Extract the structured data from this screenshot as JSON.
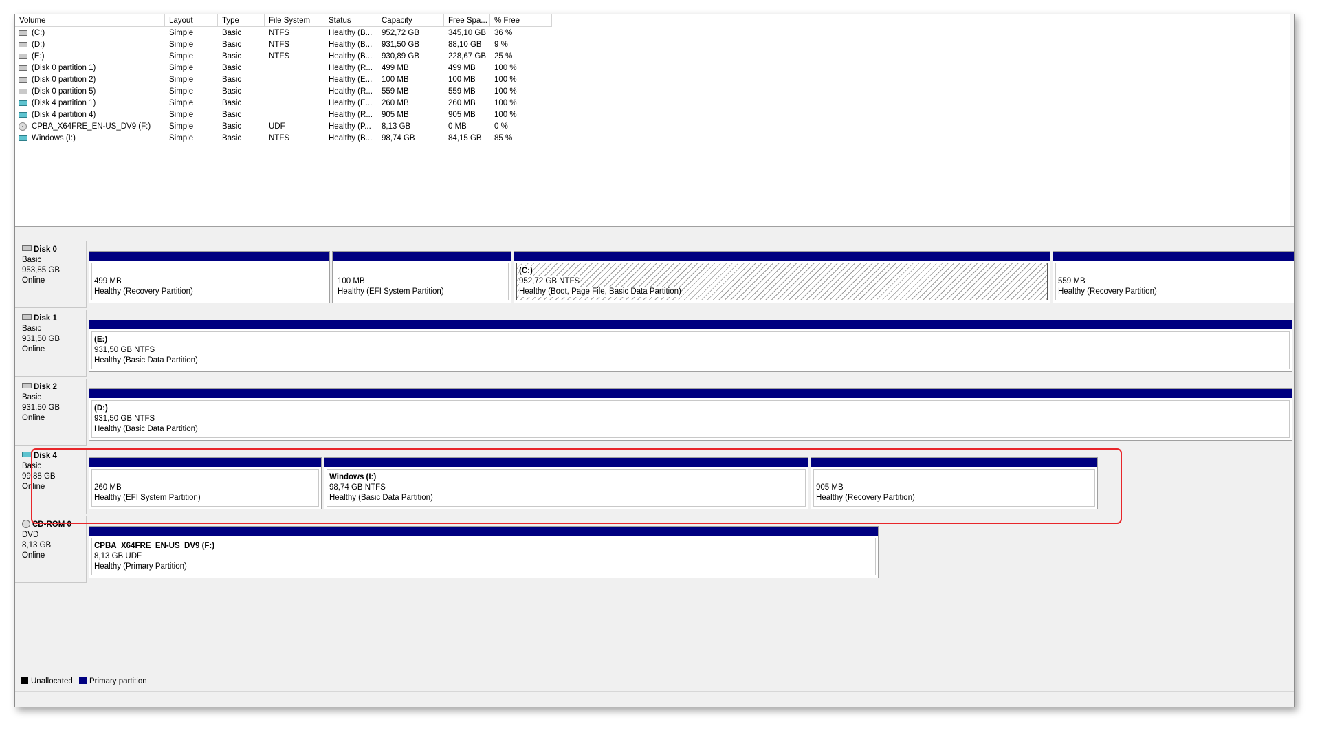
{
  "columns": [
    "Volume",
    "Layout",
    "Type",
    "File System",
    "Status",
    "Capacity",
    "Free Spa...",
    "% Free"
  ],
  "volumes": [
    {
      "icon": "disk-icon",
      "name": "(C:)",
      "layout": "Simple",
      "type": "Basic",
      "fs": "NTFS",
      "status": "Healthy (B...",
      "capacity": "952,72 GB",
      "free": "345,10 GB",
      "pct": "36 %"
    },
    {
      "icon": "disk-icon",
      "name": "(D:)",
      "layout": "Simple",
      "type": "Basic",
      "fs": "NTFS",
      "status": "Healthy (B...",
      "capacity": "931,50 GB",
      "free": "88,10 GB",
      "pct": "9 %"
    },
    {
      "icon": "disk-icon",
      "name": "(E:)",
      "layout": "Simple",
      "type": "Basic",
      "fs": "NTFS",
      "status": "Healthy (B...",
      "capacity": "930,89 GB",
      "free": "228,67 GB",
      "pct": "25 %"
    },
    {
      "icon": "disk-icon",
      "name": "(Disk 0 partition 1)",
      "layout": "Simple",
      "type": "Basic",
      "fs": "",
      "status": "Healthy (R...",
      "capacity": "499 MB",
      "free": "499 MB",
      "pct": "100 %"
    },
    {
      "icon": "disk-icon",
      "name": "(Disk 0 partition 2)",
      "layout": "Simple",
      "type": "Basic",
      "fs": "",
      "status": "Healthy (E...",
      "capacity": "100 MB",
      "free": "100 MB",
      "pct": "100 %"
    },
    {
      "icon": "disk-icon",
      "name": "(Disk 0 partition 5)",
      "layout": "Simple",
      "type": "Basic",
      "fs": "",
      "status": "Healthy (R...",
      "capacity": "559 MB",
      "free": "559 MB",
      "pct": "100 %"
    },
    {
      "icon": "usb-disk-icon",
      "name": "(Disk 4 partition 1)",
      "layout": "Simple",
      "type": "Basic",
      "fs": "",
      "status": "Healthy (E...",
      "capacity": "260 MB",
      "free": "260 MB",
      "pct": "100 %"
    },
    {
      "icon": "usb-disk-icon",
      "name": "(Disk 4 partition 4)",
      "layout": "Simple",
      "type": "Basic",
      "fs": "",
      "status": "Healthy (R...",
      "capacity": "905 MB",
      "free": "905 MB",
      "pct": "100 %"
    },
    {
      "icon": "cd-icon",
      "name": "CPBA_X64FRE_EN-US_DV9 (F:)",
      "layout": "Simple",
      "type": "Basic",
      "fs": "UDF",
      "status": "Healthy (P...",
      "capacity": "8,13 GB",
      "free": "0 MB",
      "pct": "0 %"
    },
    {
      "icon": "usb-disk-icon",
      "name": "Windows (I:)",
      "layout": "Simple",
      "type": "Basic",
      "fs": "NTFS",
      "status": "Healthy (B...",
      "capacity": "98,74 GB",
      "free": "84,15 GB",
      "pct": "85 %"
    }
  ],
  "disks": [
    {
      "name": "Disk 0",
      "kind": "Basic",
      "size": "953,85 GB",
      "state": "Online",
      "icon": "disk-icon",
      "partitions": [
        {
          "name": "",
          "size": "499 MB",
          "status": "Healthy (Recovery Partition)"
        },
        {
          "name": "",
          "size": "100 MB",
          "status": "Healthy (EFI System Partition)"
        },
        {
          "name": "(C:)",
          "size": "952,72 GB NTFS",
          "status": "Healthy (Boot, Page File, Basic Data Partition)"
        },
        {
          "name": "",
          "size": "559 MB",
          "status": "Healthy (Recovery Partition)"
        }
      ]
    },
    {
      "name": "Disk 1",
      "kind": "Basic",
      "size": "931,50 GB",
      "state": "Online",
      "icon": "disk-icon",
      "partitions": [
        {
          "name": "(E:)",
          "size": "931,50 GB NTFS",
          "status": "Healthy (Basic Data Partition)"
        }
      ]
    },
    {
      "name": "Disk 2",
      "kind": "Basic",
      "size": "931,50 GB",
      "state": "Online",
      "icon": "disk-icon",
      "partitions": [
        {
          "name": "(D:)",
          "size": "931,50 GB NTFS",
          "status": "Healthy (Basic Data Partition)"
        }
      ]
    },
    {
      "name": "Disk 4",
      "kind": "Basic",
      "size": "99,88 GB",
      "state": "Online",
      "icon": "usb-disk-icon",
      "partitions": [
        {
          "name": "",
          "size": "260 MB",
          "status": "Healthy (EFI System Partition)"
        },
        {
          "name": "Windows  (I:)",
          "size": "98,74 GB NTFS",
          "status": "Healthy (Basic Data Partition)"
        },
        {
          "name": "",
          "size": "905 MB",
          "status": "Healthy (Recovery Partition)"
        }
      ]
    },
    {
      "name": "CD-ROM 0",
      "kind": "DVD",
      "size": "8,13 GB",
      "state": "Online",
      "icon": "cd-icon",
      "partitions": [
        {
          "name": "CPBA_X64FRE_EN-US_DV9  (F:)",
          "size": "8,13 GB UDF",
          "status": "Healthy (Primary Partition)"
        }
      ]
    }
  ],
  "legend": {
    "unallocated": "Unallocated",
    "primary": "Primary partition"
  },
  "colors": {
    "primary_bar": "#000080",
    "highlight": "#e8262a",
    "usb_icon": "#5ec3cf"
  }
}
